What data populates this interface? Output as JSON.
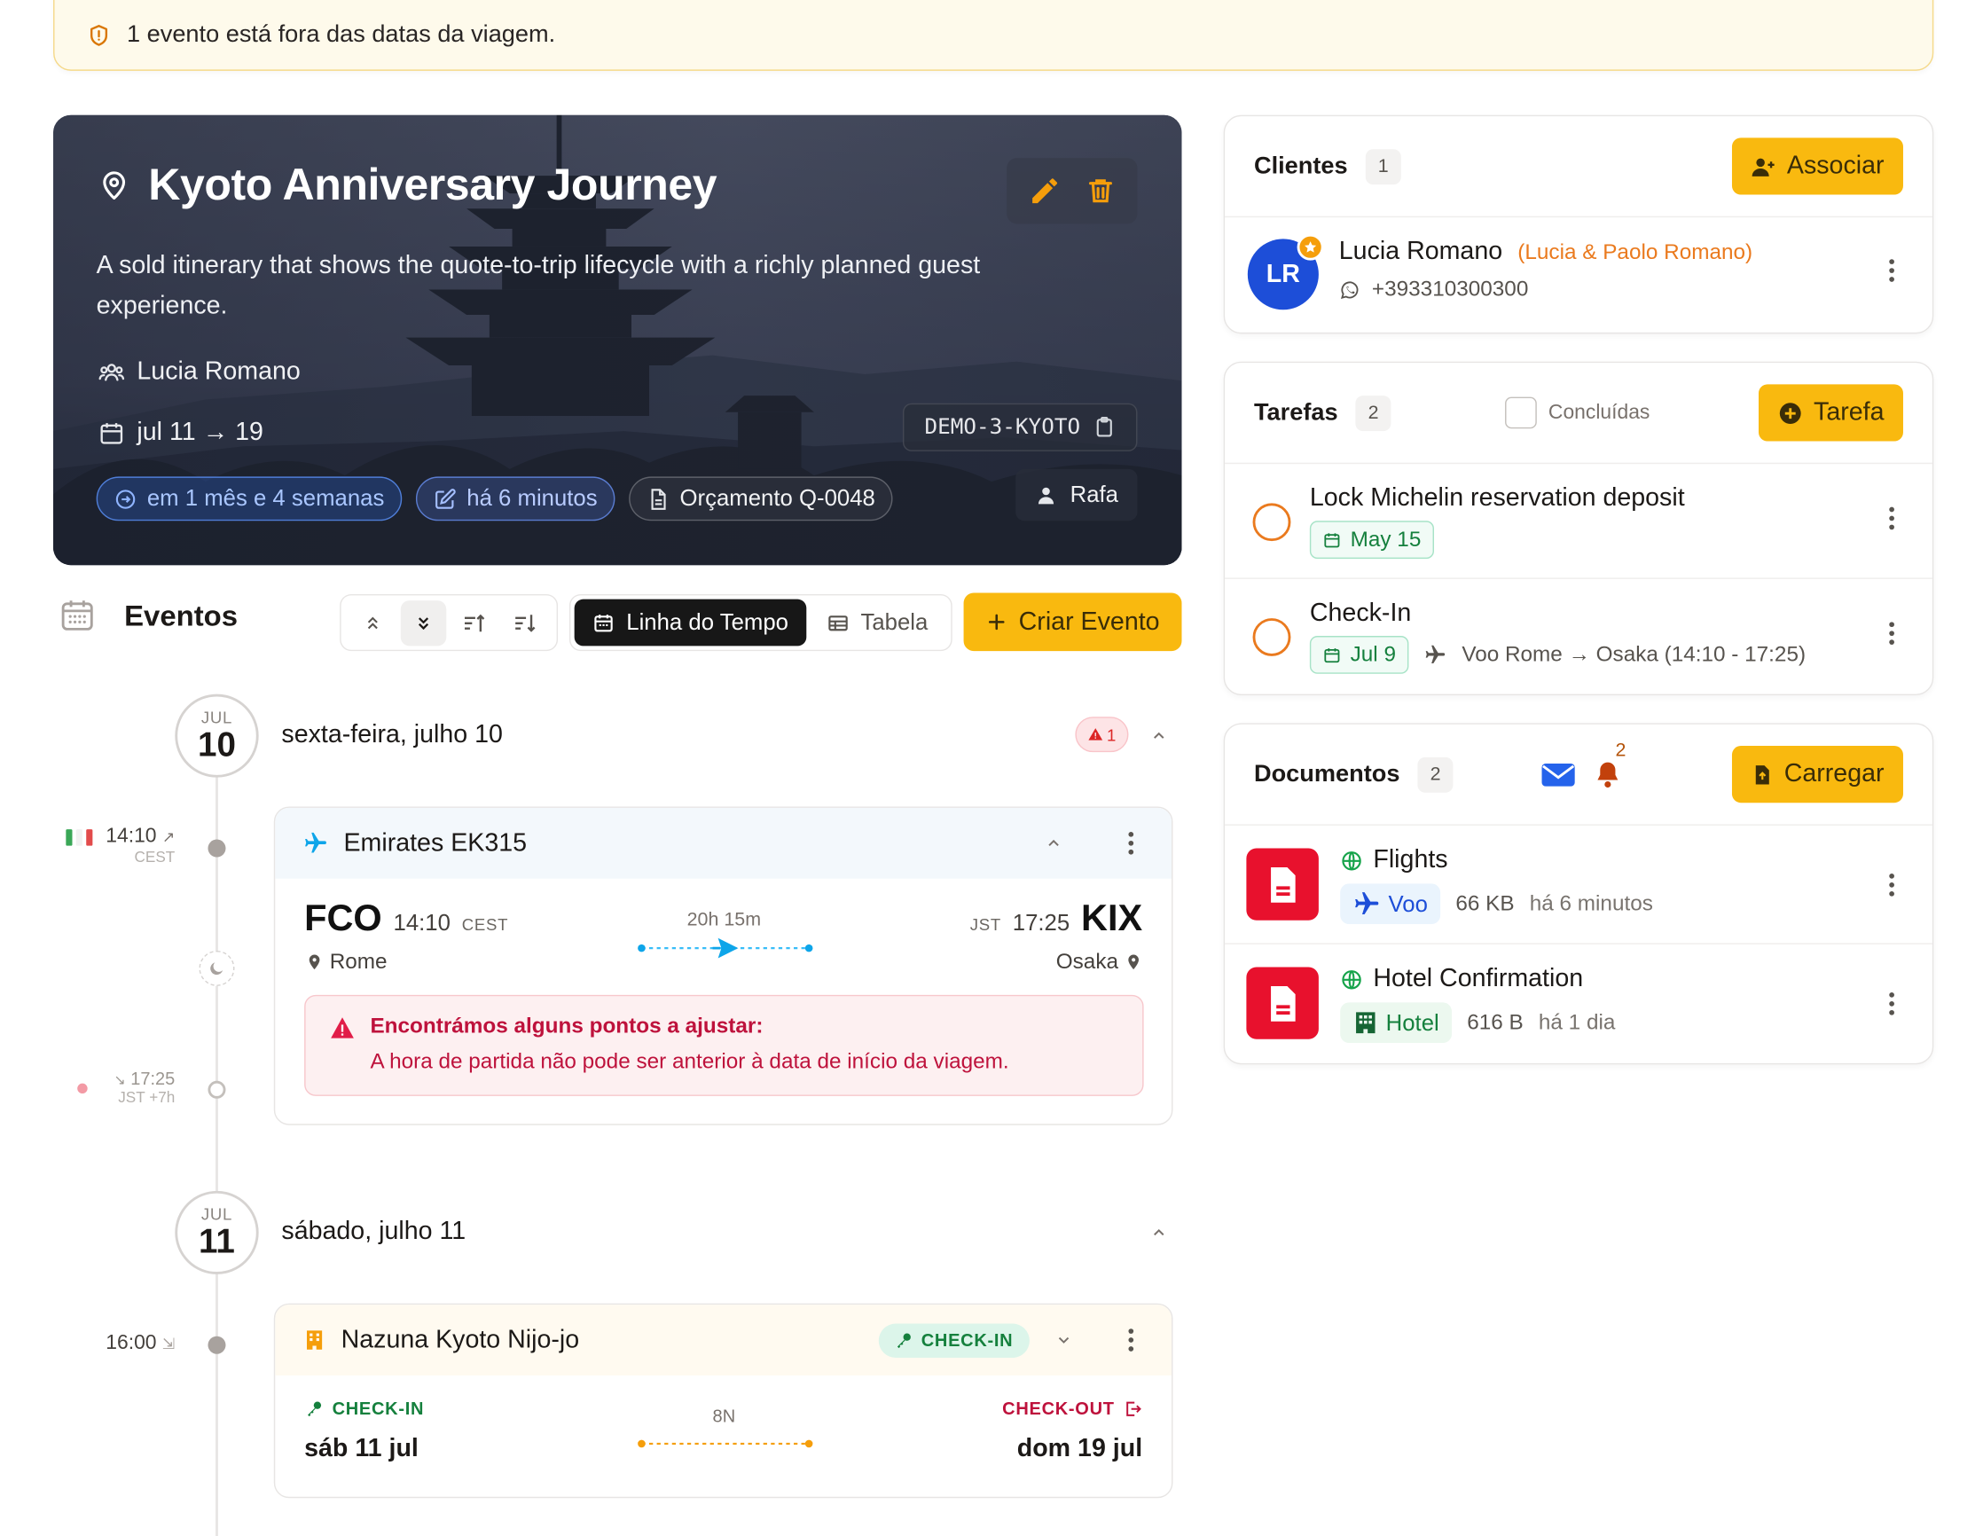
{
  "banner": {
    "text": "1 evento está fora das datas da viagem."
  },
  "trip": {
    "title": "Kyoto Anniversary Journey",
    "description": "A sold itinerary that shows the quote-to-trip lifecycle with a richly planned guest experience.",
    "client_name": "Lucia Romano",
    "dates": "jul 11 → 19",
    "code": "DEMO-3-KYOTO",
    "tags": {
      "countdown": "em 1 mês e 4 semanas",
      "updated": "há 6 minutos",
      "quote": "Orçamento Q-0048"
    },
    "owner": "Rafa"
  },
  "events": {
    "title": "Eventos",
    "view_timeline": "Linha do Tempo",
    "view_table": "Tabela",
    "create_label": "Criar Evento",
    "days": [
      {
        "month": "JUL",
        "day": "10",
        "label": "sexta-feira, julho 10",
        "error_count": "1"
      },
      {
        "month": "JUL",
        "day": "11",
        "label": "sábado, julho 11"
      }
    ],
    "flight": {
      "title": "Emirates EK315",
      "dep_time_left": "14:10",
      "dep_tz_left": "CEST",
      "arr_time_left": "17:25",
      "arr_tz_left": "JST +7h",
      "from_code": "FCO",
      "from_time": "14:10",
      "from_tz": "CEST",
      "from_city": "Rome",
      "duration": "20h 15m",
      "to_tz": "JST",
      "to_time": "17:25",
      "to_code": "KIX",
      "to_city": "Osaka",
      "error_title": "Encontrámos alguns pontos a ajustar:",
      "error_detail": "A hora de partida não pode ser anterior à data de início da viagem."
    },
    "hotel": {
      "time_left": "16:00",
      "title": "Nazuna Kyoto Nijo-jo",
      "status_badge": "CHECK-IN",
      "checkin_label": "CHECK-IN",
      "checkin_date": "sáb 11 jul",
      "nights": "8N",
      "checkout_label": "CHECK-OUT",
      "checkout_date": "dom 19 jul"
    }
  },
  "clients": {
    "title": "Clientes",
    "count": "1",
    "button": "Associar",
    "items": [
      {
        "initials": "LR",
        "name": "Lucia Romano",
        "group": "(Lucia & Paolo Romano)",
        "phone": "+393310300300"
      }
    ]
  },
  "tasks": {
    "title": "Tarefas",
    "count": "2",
    "filter_label": "Concluídas",
    "button": "Tarefa",
    "items": [
      {
        "title": "Lock Michelin reservation deposit",
        "date": "May 15"
      },
      {
        "title": "Check-In",
        "date": "Jul 9",
        "linked": "Voo Rome → Osaka (14:10 - 17:25)"
      }
    ]
  },
  "documents": {
    "title": "Documentos",
    "count": "2",
    "notif_count": "2",
    "button": "Carregar",
    "items": [
      {
        "title": "Flights",
        "type": "Voo",
        "size": "66 KB",
        "age": "há 6 minutos"
      },
      {
        "title": "Hotel Confirmation",
        "type": "Hotel",
        "size": "616 B",
        "age": "há 1 dia"
      }
    ]
  }
}
